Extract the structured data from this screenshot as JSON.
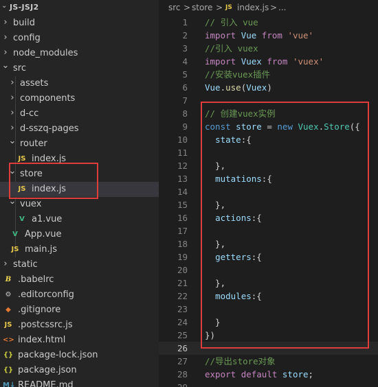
{
  "explorer": {
    "project_chevron": "⌄",
    "project_title": "JS-JSJ2",
    "items": [
      {
        "label": "build",
        "kind": "folder",
        "expanded": false
      },
      {
        "label": "config",
        "kind": "folder",
        "expanded": false
      },
      {
        "label": "node_modules",
        "kind": "folder",
        "expanded": false
      },
      {
        "label": "src",
        "kind": "folder",
        "expanded": true
      },
      {
        "label": "assets",
        "kind": "folder",
        "expanded": false
      },
      {
        "label": "components",
        "kind": "folder",
        "expanded": false
      },
      {
        "label": "d-cc",
        "kind": "folder",
        "expanded": false
      },
      {
        "label": "d-sszq-pages",
        "kind": "folder",
        "expanded": false
      },
      {
        "label": "router",
        "kind": "folder",
        "expanded": true
      },
      {
        "label": "index.js",
        "kind": "js",
        "icon_text": "JS"
      },
      {
        "label": "store",
        "kind": "folder",
        "expanded": true
      },
      {
        "label": "index.js",
        "kind": "js",
        "icon_text": "JS"
      },
      {
        "label": "vuex",
        "kind": "folder",
        "expanded": true
      },
      {
        "label": "a1.vue",
        "kind": "vue",
        "icon_text": "V"
      },
      {
        "label": "App.vue",
        "kind": "vue",
        "icon_text": "V"
      },
      {
        "label": "main.js",
        "kind": "js",
        "icon_text": "JS"
      },
      {
        "label": "static",
        "kind": "folder",
        "expanded": false
      },
      {
        "label": ".babelrc",
        "kind": "babel",
        "icon_text": "B"
      },
      {
        "label": ".editorconfig",
        "kind": "gear",
        "icon_text": "⚙"
      },
      {
        "label": ".gitignore",
        "kind": "git",
        "icon_text": "◆"
      },
      {
        "label": ".postcssrc.js",
        "kind": "js",
        "icon_text": "JS"
      },
      {
        "label": "index.html",
        "kind": "html",
        "icon_text": "<>"
      },
      {
        "label": "package-lock.json",
        "kind": "json",
        "icon_text": "{}"
      },
      {
        "label": "package.json",
        "kind": "json",
        "icon_text": "{}"
      },
      {
        "label": "README.md",
        "kind": "md",
        "icon_text": "M↓"
      }
    ]
  },
  "breadcrumb": {
    "folder1": "src",
    "sep1": ">",
    "folder2": "store",
    "sep2": ">",
    "file_icon": "JS",
    "file": "index.js",
    "sep3": ">",
    "ellipsis": "..."
  },
  "editor": {
    "lines": [
      {
        "n": "1",
        "tokens": [
          [
            "comment",
            "// 引入 vue"
          ]
        ]
      },
      {
        "n": "2",
        "tokens": [
          [
            "kw",
            "import"
          ],
          [
            "punc",
            " "
          ],
          [
            "var",
            "Vue"
          ],
          [
            "punc",
            " "
          ],
          [
            "kw",
            "from"
          ],
          [
            "punc",
            " "
          ],
          [
            "str",
            "'vue'"
          ]
        ]
      },
      {
        "n": "3",
        "tokens": [
          [
            "comment",
            "//引入 vuex"
          ]
        ]
      },
      {
        "n": "4",
        "tokens": [
          [
            "kw",
            "import"
          ],
          [
            "punc",
            " "
          ],
          [
            "var",
            "Vuex"
          ],
          [
            "punc",
            " "
          ],
          [
            "kw",
            "from"
          ],
          [
            "punc",
            " "
          ],
          [
            "str",
            "'vuex'"
          ]
        ]
      },
      {
        "n": "5",
        "tokens": [
          [
            "comment",
            "//安装vuex插件"
          ]
        ]
      },
      {
        "n": "6",
        "tokens": [
          [
            "var",
            "Vue"
          ],
          [
            "punc",
            "."
          ],
          [
            "fn",
            "use"
          ],
          [
            "punc",
            "("
          ],
          [
            "var",
            "Vuex"
          ],
          [
            "punc",
            ")"
          ]
        ]
      },
      {
        "n": "7",
        "tokens": []
      },
      {
        "n": "8",
        "tokens": [
          [
            "comment",
            "// 创建vuex实例"
          ]
        ]
      },
      {
        "n": "9",
        "tokens": [
          [
            "decl",
            "const"
          ],
          [
            "punc",
            " "
          ],
          [
            "var",
            "store"
          ],
          [
            "punc",
            " = "
          ],
          [
            "decl",
            "new"
          ],
          [
            "punc",
            " "
          ],
          [
            "cls",
            "Vuex"
          ],
          [
            "punc",
            "."
          ],
          [
            "cls",
            "Store"
          ],
          [
            "punc",
            "({"
          ]
        ]
      },
      {
        "n": "10",
        "tokens": [
          [
            "punc",
            "  "
          ],
          [
            "prop",
            "state"
          ],
          [
            "punc",
            ":{"
          ]
        ]
      },
      {
        "n": "11",
        "tokens": []
      },
      {
        "n": "12",
        "tokens": [
          [
            "punc",
            "  },"
          ]
        ]
      },
      {
        "n": "13",
        "tokens": [
          [
            "punc",
            "  "
          ],
          [
            "prop",
            "mutations"
          ],
          [
            "punc",
            ":{"
          ]
        ]
      },
      {
        "n": "14",
        "tokens": []
      },
      {
        "n": "15",
        "tokens": [
          [
            "punc",
            "  },"
          ]
        ]
      },
      {
        "n": "16",
        "tokens": [
          [
            "punc",
            "  "
          ],
          [
            "prop",
            "actions"
          ],
          [
            "punc",
            ":{"
          ]
        ]
      },
      {
        "n": "17",
        "tokens": []
      },
      {
        "n": "18",
        "tokens": [
          [
            "punc",
            "  },"
          ]
        ]
      },
      {
        "n": "19",
        "tokens": [
          [
            "punc",
            "  "
          ],
          [
            "prop",
            "getters"
          ],
          [
            "punc",
            ":{"
          ]
        ]
      },
      {
        "n": "20",
        "tokens": []
      },
      {
        "n": "21",
        "tokens": [
          [
            "punc",
            "  },"
          ]
        ]
      },
      {
        "n": "22",
        "tokens": [
          [
            "punc",
            "  "
          ],
          [
            "prop",
            "modules"
          ],
          [
            "punc",
            ":{"
          ]
        ]
      },
      {
        "n": "23",
        "tokens": []
      },
      {
        "n": "24",
        "tokens": [
          [
            "punc",
            "  }"
          ]
        ]
      },
      {
        "n": "25",
        "tokens": [
          [
            "punc",
            "})"
          ]
        ]
      },
      {
        "n": "26",
        "tokens": [],
        "current": true
      },
      {
        "n": "27",
        "tokens": [
          [
            "comment",
            "//导出store对象"
          ]
        ]
      },
      {
        "n": "28",
        "tokens": [
          [
            "kw",
            "export"
          ],
          [
            "punc",
            " "
          ],
          [
            "kw",
            "default"
          ],
          [
            "punc",
            " "
          ],
          [
            "var",
            "store"
          ],
          [
            "punc",
            ";"
          ]
        ]
      },
      {
        "n": "29",
        "tokens": []
      }
    ]
  },
  "colors": {
    "highlight_box": "#e03c3c",
    "sidebar_bg": "#252526",
    "editor_bg": "#1e1e1e",
    "selected_row": "#37373d"
  }
}
